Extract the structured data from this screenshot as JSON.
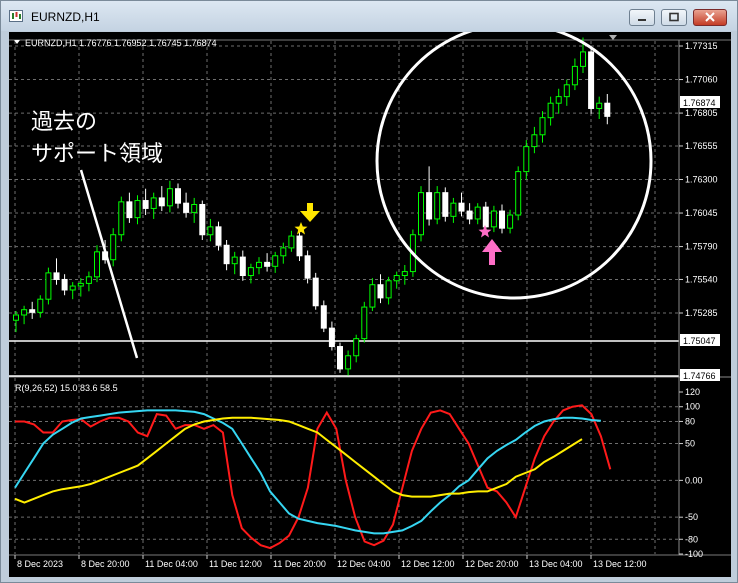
{
  "window": {
    "title": "EURNZD,H1"
  },
  "main_chart": {
    "info_text": "EURNZD,H1  1.76776 1.76952 1.76745 1.76874",
    "price_labels": [
      "1.77315",
      "1.77060",
      "1.76805",
      "1.76555",
      "1.76300",
      "1.76045",
      "1.75790",
      "1.75540",
      "1.75285"
    ],
    "price_levels": [
      1.77315,
      1.7706,
      1.76805,
      1.76555,
      1.763,
      1.76045,
      1.7579,
      1.7554,
      1.75285
    ],
    "current_price": "1.76874",
    "line_tags": [
      "1.75047",
      "1.74766"
    ],
    "annotation_text": [
      "過去の",
      "サポート領域"
    ]
  },
  "oscillator": {
    "header": "R(9,26,52) 15.0 83.6 58.5",
    "scale_labels": [
      "120",
      "100",
      "80",
      "50",
      "0.00",
      "-50",
      "-80",
      "-100"
    ],
    "scale_values": [
      120,
      100,
      80,
      50,
      0,
      -50,
      -80,
      -100
    ]
  },
  "time_axis": [
    "8 Dec 2023",
    "8 Dec 20:00",
    "11 Dec 04:00",
    "11 Dec 12:00",
    "11 Dec 20:00",
    "12 Dec 04:00",
    "12 Dec 12:00",
    "12 Dec 20:00",
    "13 Dec 04:00",
    "13 Dec 12:00"
  ],
  "colors": {
    "bull": "#00ff00",
    "bear": "#ffffff",
    "rsi_fast": "#ff1a1a",
    "rsi_mid": "#36d6f2",
    "rsi_slow": "#ffee00",
    "star_yellow": "#ffe600",
    "star_pink": "#ff6ec7"
  },
  "chart_data": [
    {
      "type": "candlestick",
      "title": "EURNZD,H1",
      "x_labels": [
        "8 Dec 2023",
        "8 Dec 20:00",
        "11 Dec 04:00",
        "11 Dec 12:00",
        "11 Dec 20:00",
        "12 Dec 04:00",
        "12 Dec 12:00",
        "12 Dec 20:00",
        "13 Dec 04:00",
        "13 Dec 12:00"
      ],
      "ylim": [
        1.7461,
        1.7745
      ],
      "series": [
        {
          "candles": [
            [
              1.7523,
              1.753,
              1.7514,
              1.7527
            ],
            [
              1.7527,
              1.7534,
              1.752,
              1.7531
            ],
            [
              1.7531,
              1.7537,
              1.7524,
              1.7529
            ],
            [
              1.7529,
              1.7542,
              1.7525,
              1.7539
            ],
            [
              1.7539,
              1.7563,
              1.7535,
              1.7559
            ],
            [
              1.7559,
              1.757,
              1.755,
              1.7554
            ],
            [
              1.7554,
              1.7558,
              1.7542,
              1.7546
            ],
            [
              1.7546,
              1.7552,
              1.7539,
              1.7549
            ],
            [
              1.7549,
              1.7555,
              1.7541,
              1.7551
            ],
            [
              1.7551,
              1.756,
              1.7545,
              1.7556
            ],
            [
              1.7556,
              1.758,
              1.7552,
              1.7575
            ],
            [
              1.7575,
              1.7584,
              1.7566,
              1.7569
            ],
            [
              1.7569,
              1.7593,
              1.7564,
              1.7588
            ],
            [
              1.7588,
              1.7617,
              1.7583,
              1.7613
            ],
            [
              1.7613,
              1.762,
              1.7597,
              1.7601
            ],
            [
              1.7601,
              1.7618,
              1.7596,
              1.7614
            ],
            [
              1.7614,
              1.7623,
              1.7603,
              1.7608
            ],
            [
              1.7608,
              1.762,
              1.76,
              1.7616
            ],
            [
              1.7616,
              1.7625,
              1.7606,
              1.761
            ],
            [
              1.761,
              1.7629,
              1.7605,
              1.7623
            ],
            [
              1.7623,
              1.7627,
              1.7608,
              1.7612
            ],
            [
              1.7612,
              1.762,
              1.7601,
              1.7605
            ],
            [
              1.7605,
              1.7616,
              1.7597,
              1.7611
            ],
            [
              1.7611,
              1.7614,
              1.7584,
              1.7588
            ],
            [
              1.7588,
              1.76,
              1.7583,
              1.7594
            ],
            [
              1.7594,
              1.7598,
              1.7576,
              1.758
            ],
            [
              1.758,
              1.7584,
              1.7561,
              1.7566
            ],
            [
              1.7566,
              1.7575,
              1.7558,
              1.7571
            ],
            [
              1.7571,
              1.7576,
              1.7553,
              1.7557
            ],
            [
              1.7557,
              1.7566,
              1.7551,
              1.7563
            ],
            [
              1.7563,
              1.7571,
              1.7558,
              1.7567
            ],
            [
              1.7567,
              1.7574,
              1.756,
              1.7564
            ],
            [
              1.7564,
              1.7575,
              1.7559,
              1.7572
            ],
            [
              1.7572,
              1.7582,
              1.7566,
              1.7578
            ],
            [
              1.7578,
              1.7591,
              1.7575,
              1.7587
            ],
            [
              1.7587,
              1.7593,
              1.7568,
              1.7572
            ],
            [
              1.7572,
              1.7576,
              1.7551,
              1.7555
            ],
            [
              1.7555,
              1.7559,
              1.7531,
              1.7534
            ],
            [
              1.7534,
              1.7538,
              1.7514,
              1.7517
            ],
            [
              1.7517,
              1.7522,
              1.75,
              1.7503
            ],
            [
              1.7503,
              1.7506,
              1.7483,
              1.7486
            ],
            [
              1.7486,
              1.75,
              1.7481,
              1.7496
            ],
            [
              1.7496,
              1.7512,
              1.7491,
              1.7509
            ],
            [
              1.7509,
              1.7537,
              1.7506,
              1.7533
            ],
            [
              1.7533,
              1.7555,
              1.753,
              1.755
            ],
            [
              1.755,
              1.7558,
              1.7536,
              1.754
            ],
            [
              1.754,
              1.7556,
              1.7535,
              1.7553
            ],
            [
              1.7553,
              1.756,
              1.7547,
              1.7557
            ],
            [
              1.7557,
              1.7565,
              1.755,
              1.756
            ],
            [
              1.756,
              1.7592,
              1.7556,
              1.7588
            ],
            [
              1.7588,
              1.7625,
              1.7583,
              1.762
            ],
            [
              1.762,
              1.764,
              1.7595,
              1.76
            ],
            [
              1.76,
              1.7625,
              1.7596,
              1.762
            ],
            [
              1.762,
              1.7624,
              1.7598,
              1.7602
            ],
            [
              1.7602,
              1.7616,
              1.7597,
              1.7612
            ],
            [
              1.7612,
              1.762,
              1.7602,
              1.7606
            ],
            [
              1.7606,
              1.7612,
              1.7596,
              1.76
            ],
            [
              1.76,
              1.7612,
              1.7596,
              1.7609
            ],
            [
              1.7609,
              1.7613,
              1.759,
              1.7594
            ],
            [
              1.7594,
              1.761,
              1.759,
              1.7606
            ],
            [
              1.7606,
              1.7611,
              1.7589,
              1.7593
            ],
            [
              1.7593,
              1.7607,
              1.7589,
              1.7603
            ],
            [
              1.7603,
              1.764,
              1.7599,
              1.7636
            ],
            [
              1.7636,
              1.766,
              1.763,
              1.7655
            ],
            [
              1.7655,
              1.767,
              1.765,
              1.7664
            ],
            [
              1.7664,
              1.7682,
              1.7658,
              1.7677
            ],
            [
              1.7677,
              1.7693,
              1.7671,
              1.7688
            ],
            [
              1.7688,
              1.7699,
              1.768,
              1.7693
            ],
            [
              1.7693,
              1.7706,
              1.7686,
              1.7702
            ],
            [
              1.7702,
              1.7722,
              1.7698,
              1.7716
            ],
            [
              1.7716,
              1.7738,
              1.7711,
              1.7727
            ],
            [
              1.7727,
              1.7731,
              1.768,
              1.7684
            ],
            [
              1.7684,
              1.7693,
              1.7676,
              1.7688
            ],
            [
              1.7688,
              1.7695,
              1.7672,
              1.7678
            ]
          ]
        }
      ]
    },
    {
      "type": "line",
      "title": "R(9,26,52)",
      "ylim": [
        -100,
        120
      ],
      "series": [
        {
          "color": "#ff1a1a",
          "values": [
            80,
            80,
            76,
            65,
            65,
            80,
            82,
            83,
            73,
            80,
            85,
            85,
            80,
            65,
            60,
            90,
            88,
            70,
            75,
            75,
            70,
            75,
            65,
            -20,
            -65,
            -78,
            -88,
            -92,
            -85,
            -75,
            -50,
            -10,
            70,
            92,
            70,
            0,
            -50,
            -83,
            -88,
            -82,
            -60,
            -10,
            40,
            70,
            92,
            95,
            90,
            70,
            50,
            20,
            -10,
            -15,
            -30,
            -50,
            -10,
            30,
            60,
            80,
            95,
            100,
            102,
            90,
            60,
            15
          ]
        },
        {
          "color": "#36d6f2",
          "values": [
            -10,
            10,
            30,
            50,
            62,
            70,
            78,
            84,
            86,
            88,
            90,
            92,
            93,
            94,
            95,
            95,
            95,
            95,
            94,
            93,
            90,
            84,
            78,
            70,
            50,
            30,
            10,
            -15,
            -30,
            -45,
            -52,
            -55,
            -58,
            -60,
            -62,
            -65,
            -68,
            -70,
            -72,
            -72,
            -70,
            -68,
            -62,
            -55,
            -42,
            -30,
            -20,
            -8,
            0,
            15,
            30,
            40,
            48,
            55,
            65,
            74,
            80,
            83,
            85,
            85,
            84,
            82,
            81
          ]
        },
        {
          "color": "#ffee00",
          "values": [
            -25,
            -30,
            -25,
            -20,
            -15,
            -12,
            -10,
            -8,
            -5,
            0,
            5,
            10,
            15,
            20,
            30,
            40,
            50,
            60,
            70,
            76,
            80,
            82,
            84,
            85,
            85,
            85,
            84,
            83,
            82,
            80,
            75,
            70,
            65,
            55,
            45,
            35,
            25,
            15,
            5,
            -5,
            -15,
            -20,
            -22,
            -22,
            -22,
            -20,
            -18,
            -18,
            -16,
            -15,
            -15,
            -10,
            -5,
            5,
            10,
            15,
            25,
            32,
            40,
            48,
            56
          ]
        }
      ]
    }
  ]
}
